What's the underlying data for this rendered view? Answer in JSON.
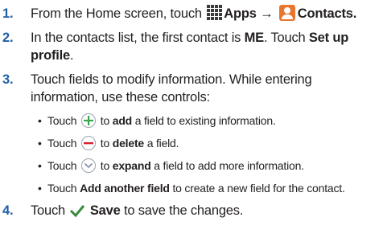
{
  "steps": [
    {
      "number": "1.",
      "line1_pre": "From the Home screen, touch ",
      "apps_label": "Apps",
      "arrow": " → ",
      "contacts_label": "Contacts",
      "period": "."
    },
    {
      "number": "2.",
      "line1_pre": "In the contacts list, the first contact is ",
      "me_label": "ME",
      "line1_mid": ". Touch ",
      "setup_label_1": "Set up",
      "setup_label_2": "profile",
      "period": "."
    },
    {
      "number": "3.",
      "line1": "Touch fields to modify information. While entering",
      "line2": "information, use these controls:"
    },
    {
      "number": "4.",
      "pre": "Touch ",
      "save_label": "Save",
      "post": " to save the changes."
    }
  ],
  "bullets": [
    {
      "dot": "•",
      "pre": "Touch ",
      "bold": "add",
      "post": " a field to existing information.",
      "icon": "add-circle-icon"
    },
    {
      "dot": "•",
      "pre": "Touch ",
      "bold": "delete",
      "post": " a field.",
      "icon": "remove-circle-icon"
    },
    {
      "dot": "•",
      "pre": "Touch ",
      "bold": "expand",
      "post": " a field to add more information.",
      "icon": "expand-circle-icon"
    },
    {
      "dot": "•",
      "pre": "Touch ",
      "bold": "Add another field",
      "post": " to create a new field for the contact.",
      "icon": ""
    }
  ],
  "colors": {
    "step_number": "#1f5ea8",
    "add_icon": "#3aa64b",
    "delete_icon": "#d6232f",
    "expand_icon": "#7f8fa6",
    "contacts_icon": "#e8762d",
    "checkmark": "#3c8a3c"
  }
}
